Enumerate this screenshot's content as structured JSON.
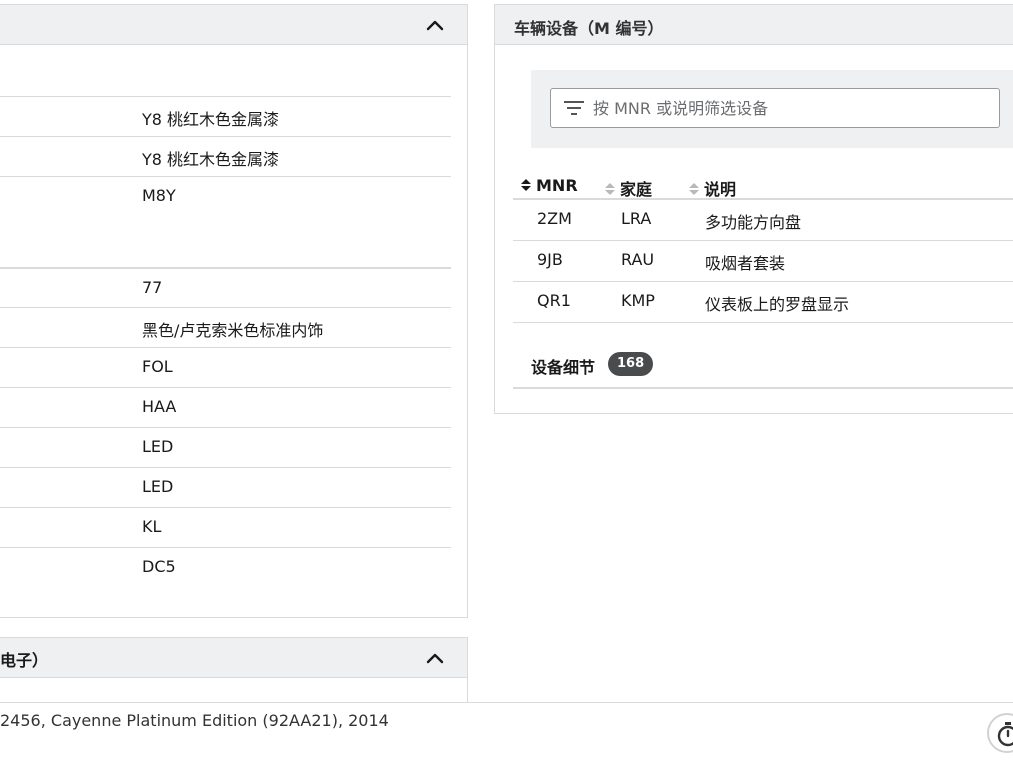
{
  "left_panel": {
    "rows": [
      {
        "value": "Y8 桃红木色金属漆"
      },
      {
        "value": "Y8 桃红木色金属漆"
      },
      {
        "value": "M8Y"
      },
      {
        "value": "77"
      },
      {
        "value": "黑色/卢克索米色标准内饰"
      },
      {
        "value": "FOL"
      },
      {
        "value": "HAA"
      },
      {
        "value": "LED"
      },
      {
        "value": "LED"
      },
      {
        "value": "KL"
      },
      {
        "value": "DC5"
      }
    ]
  },
  "left_panel_2": {
    "title": "电子）"
  },
  "right_panel": {
    "title": "车辆设备（M 编号）",
    "filter": {
      "placeholder": "按 MNR 或说明筛选设备",
      "icon": "filter-icon"
    },
    "table": {
      "columns": [
        "MNR",
        "家庭",
        "说明"
      ],
      "rows": [
        {
          "mnr": "2ZM",
          "family": "LRA",
          "desc": "多功能方向盘"
        },
        {
          "mnr": "9JB",
          "family": "RAU",
          "desc": "吸烟者套装"
        },
        {
          "mnr": "QR1",
          "family": "KMP",
          "desc": "仪表板上的罗盘显示"
        }
      ]
    },
    "details": {
      "label": "设备细节",
      "count": "168"
    }
  },
  "footer": {
    "text": "2456, Cayenne Platinum Edition (92AA21), 2014"
  },
  "colors": {
    "header_bg": "#eff0f1",
    "border": "#d8dadc",
    "badge_bg": "#4a4b4d",
    "text": "#1a1a1a"
  }
}
